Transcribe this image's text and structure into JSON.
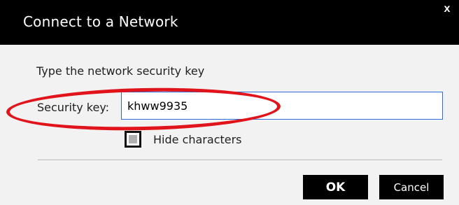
{
  "dialog": {
    "title": "Connect to a Network",
    "close_label": "x"
  },
  "form": {
    "prompt": "Type the network security key",
    "security_key_label": "Security key:",
    "security_key_value": "khww9935",
    "hide_characters_label": "Hide characters",
    "hide_characters_checked": false
  },
  "buttons": {
    "ok_label": "OK",
    "cancel_label": "Cancel"
  },
  "colors": {
    "titlebar": "#000000",
    "background": "#f2f2f2",
    "input_border": "#2b6cd8",
    "annotation": "#e1141b"
  },
  "icons": {
    "close": "close-icon"
  }
}
